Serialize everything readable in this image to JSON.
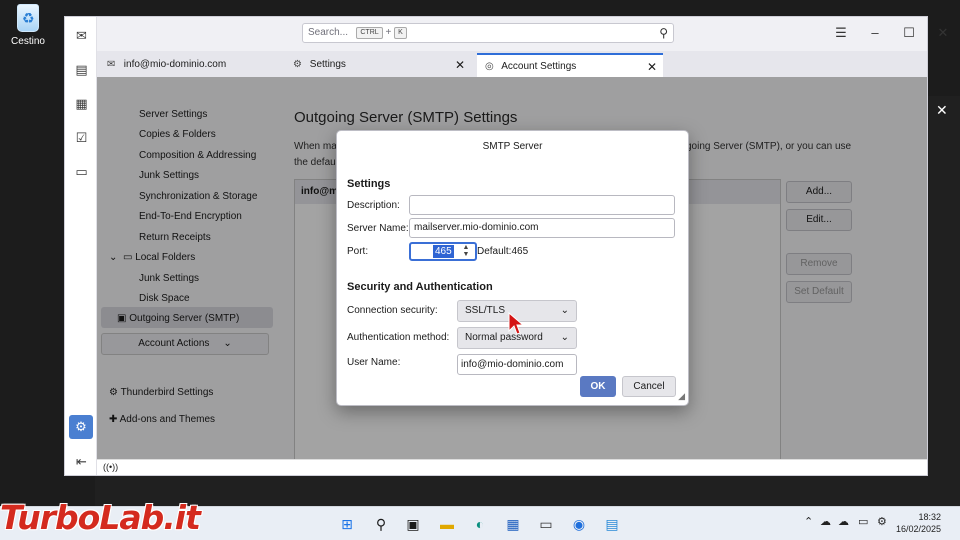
{
  "desktop": {
    "recycle_bin": "Cestino",
    "close_glyph": "✕"
  },
  "window": {
    "search": {
      "placeholder": "Search...",
      "key1": "CTRL",
      "plus": "+",
      "key2": "K"
    },
    "tabs": [
      {
        "label": "info@mio-dominio.com"
      },
      {
        "label": "Settings"
      },
      {
        "label": "Account Settings"
      }
    ]
  },
  "nav": {
    "items": [
      "Server Settings",
      "Copies & Folders",
      "Composition & Addressing",
      "Junk Settings",
      "Synchronization & Storage",
      "End-To-End Encryption",
      "Return Receipts"
    ],
    "local_folders": "Local Folders",
    "local_items": [
      "Junk Settings",
      "Disk Space"
    ],
    "outgoing": "Outgoing Server (SMTP)",
    "account_actions": "Account Actions",
    "thunderbird_settings": "Thunderbird Settings",
    "addons": "Add-ons and Themes"
  },
  "pane": {
    "title": "Outgoing Server (SMTP) Settings",
    "desc_left": "When ma",
    "desc_right": "going Server (SMTP), or you can use",
    "desc_line2": "the defau",
    "list_row": "info@m",
    "buttons": {
      "add": "Add...",
      "edit": "Edit...",
      "remove": "Remove",
      "set_default": "Set Default"
    }
  },
  "dialog": {
    "title": "SMTP Server",
    "settings_heading": "Settings",
    "description_label": "Description:",
    "description_value": "",
    "server_name_label": "Server Name:",
    "server_name_value": "mailserver.mio-dominio.com",
    "port_label": "Port:",
    "port_value": "465",
    "default_label": "Default:",
    "default_value": "465",
    "security_heading": "Security and Authentication",
    "connection_security_label": "Connection security:",
    "connection_security_value": "SSL/TLS",
    "auth_method_label": "Authentication method:",
    "auth_method_value": "Normal password",
    "user_name_label": "User Name:",
    "user_name_value": "info@mio-dominio.com",
    "ok": "OK",
    "cancel": "Cancel"
  },
  "taskbar": {
    "brand": "TurboLab.it",
    "time": "18:32",
    "date": "16/02/2025"
  },
  "colors": {
    "accent": "#2f6ed8",
    "ok_button": "#5a79c2",
    "brand": "#d42a1e"
  }
}
